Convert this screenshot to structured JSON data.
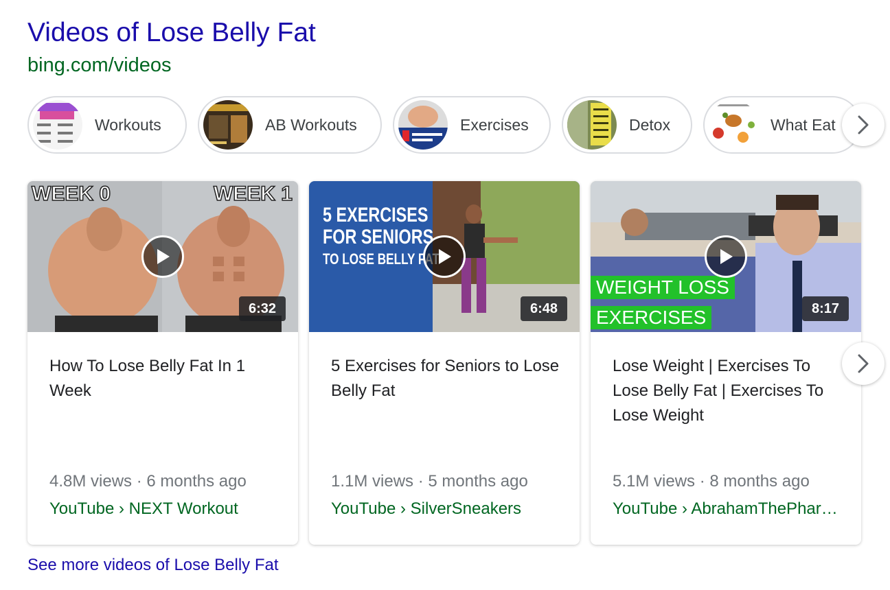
{
  "header": {
    "title": "Videos of Lose Belly Fat",
    "source": "bing.com/videos"
  },
  "chips": [
    {
      "label": "Workouts"
    },
    {
      "label": "AB Workouts"
    },
    {
      "label": "Exercises"
    },
    {
      "label": "Detox"
    },
    {
      "label": "What Eat"
    }
  ],
  "chips_next_icon": "chevron-right-icon",
  "thumb_text": {
    "week0": "WEEK 0",
    "week1": "WEEK 1",
    "seniors_line1": "5 EXERCISES",
    "seniors_line2": "FOR SENIORS",
    "seniors_line3": "TO LOSE BELLY FAT",
    "weightloss_line1": "WEIGHT LOSS",
    "weightloss_line2": "EXERCISES"
  },
  "videos": [
    {
      "title": "How To Lose Belly Fat In 1 Week",
      "duration": "6:32",
      "meta": "4.8M views · 6 months ago",
      "source": "YouTube › NEXT Workout"
    },
    {
      "title": "5 Exercises for Seniors to Lose Belly Fat",
      "duration": "6:48",
      "meta": "1.1M views · 5 months ago",
      "source": "YouTube › SilverSneakers"
    },
    {
      "title": "Lose Weight | Exercises To Lose Belly Fat | Exercises To Lose Weight",
      "duration": "8:17",
      "meta": "5.1M views · 8 months ago",
      "source": "YouTube › AbrahamThePharmacist"
    }
  ],
  "cards_next_icon": "chevron-right-icon",
  "see_more": "See more videos of Lose Belly Fat",
  "colors": {
    "link": "#1a0dab",
    "source_green": "#006621",
    "meta_gray": "#70757a",
    "badge_green": "#22c12a"
  }
}
